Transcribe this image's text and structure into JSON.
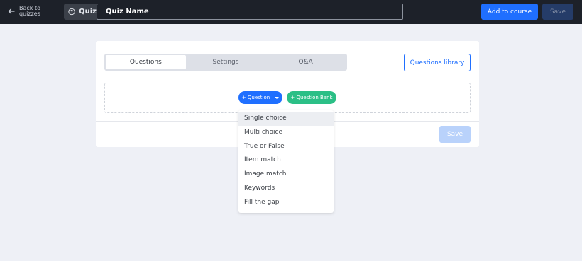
{
  "topbar": {
    "back_label": "Back to quizzes",
    "badge_label": "Quiz",
    "quiz_name_value": "Quiz Name",
    "add_to_course_label": "Add to course",
    "save_label": "Save"
  },
  "card": {
    "tabs": [
      {
        "label": "Questions",
        "active": true
      },
      {
        "label": "Settings",
        "active": false
      },
      {
        "label": "Q&A",
        "active": false
      }
    ],
    "library_label": "Questions library",
    "question_button_label": "+ Question",
    "bank_button_label": "+ Question Bank",
    "save_label": "Save"
  },
  "dropdown": {
    "items": [
      {
        "label": "Single choice",
        "highlighted": true
      },
      {
        "label": "Multi choice"
      },
      {
        "label": "True or False"
      },
      {
        "label": "Item match"
      },
      {
        "label": "Image match"
      },
      {
        "label": "Keywords"
      },
      {
        "label": "Fill the gap"
      }
    ]
  },
  "colors": {
    "topbar": "#1d2129",
    "primary": "#1f6fff",
    "green": "#2bbf86",
    "background": "#eef0f6"
  },
  "icons": {
    "back": "arrow-left-icon",
    "quiz": "question-circle-icon",
    "dropdown": "caret-down-icon"
  }
}
